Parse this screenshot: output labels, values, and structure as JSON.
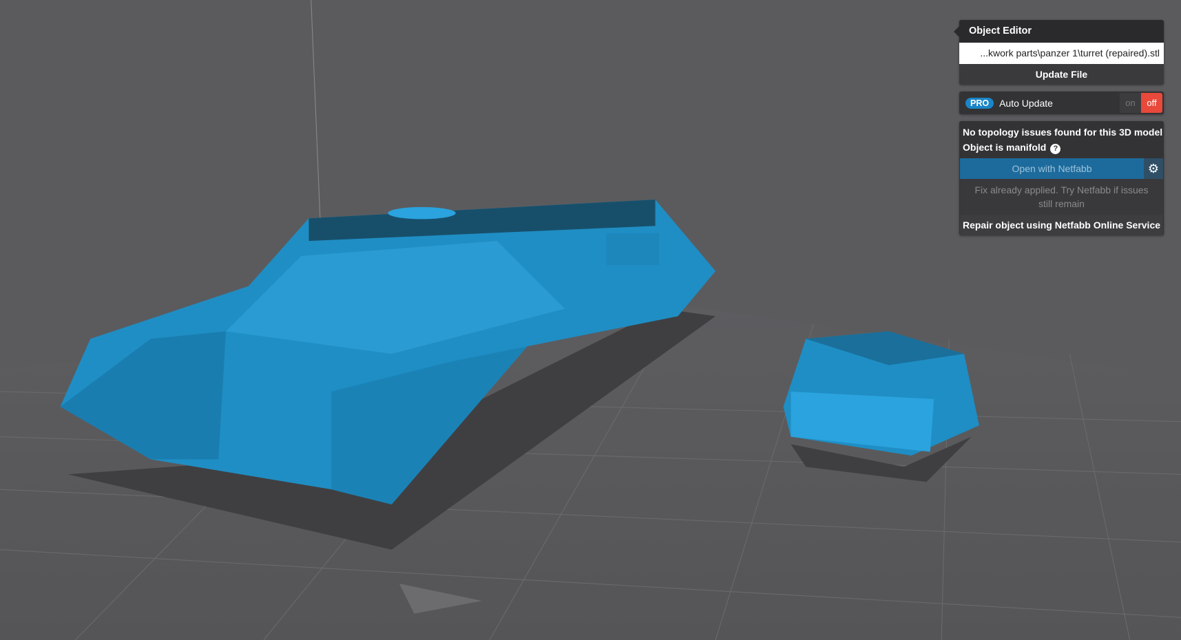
{
  "panel": {
    "title": "Object Editor",
    "file_path": "...kwork parts\\panzer 1\\turret (repaired).stl",
    "update_file": "Update File",
    "pro_badge": "PRO",
    "auto_update": "Auto Update",
    "toggle_on": "on",
    "toggle_off": "off",
    "topology_status": "No topology issues found for this 3D model",
    "manifold_status": "Object is manifold",
    "help_glyph": "?",
    "open_netfabb": "Open with Netfabb",
    "gear_glyph": "⚙",
    "fix_note": "Fix already applied. Try Netfabb if issues still remain",
    "repair_button": "Repair object using Netfabb Online Service"
  },
  "colors": {
    "model": "#1f8ec4",
    "background": "#5b5b5e",
    "toggle_off": "#e8493a"
  }
}
